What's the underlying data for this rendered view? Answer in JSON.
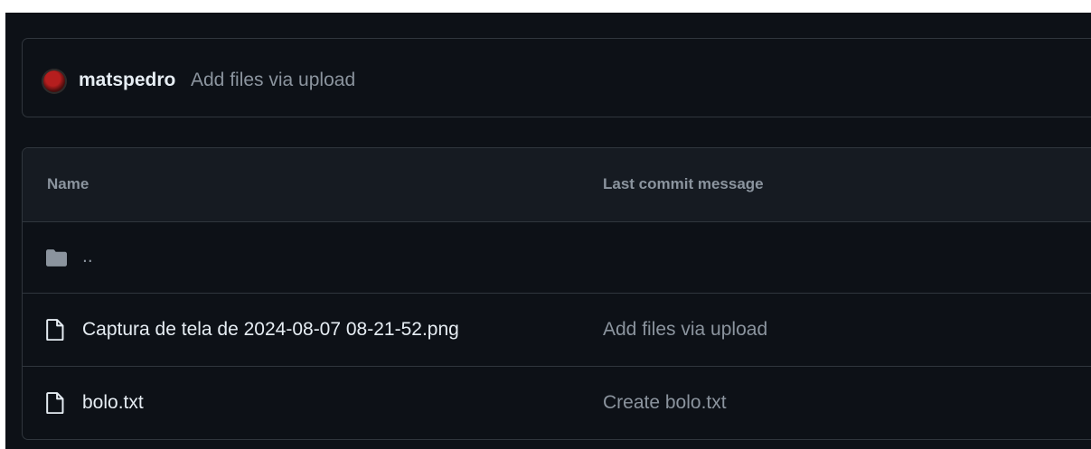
{
  "commit": {
    "author": "matspedro",
    "message": "Add files via upload",
    "avatar_icon": "avatar-icon"
  },
  "table": {
    "headers": {
      "name": "Name",
      "last_commit": "Last commit message"
    },
    "rows": [
      {
        "name": "..",
        "message": "",
        "icon": "folder-icon"
      },
      {
        "name": "Captura de tela de 2024-08-07 08-21-52.png",
        "message": "Add files via upload",
        "icon": "file-icon"
      },
      {
        "name": "bolo.txt",
        "message": "Create bolo.txt",
        "icon": "file-icon"
      }
    ]
  },
  "colors": {
    "background": "#0d1117",
    "header_bg": "#161b22",
    "border": "#30363d",
    "text_primary": "#e6edf3",
    "text_muted": "#8b949e"
  }
}
